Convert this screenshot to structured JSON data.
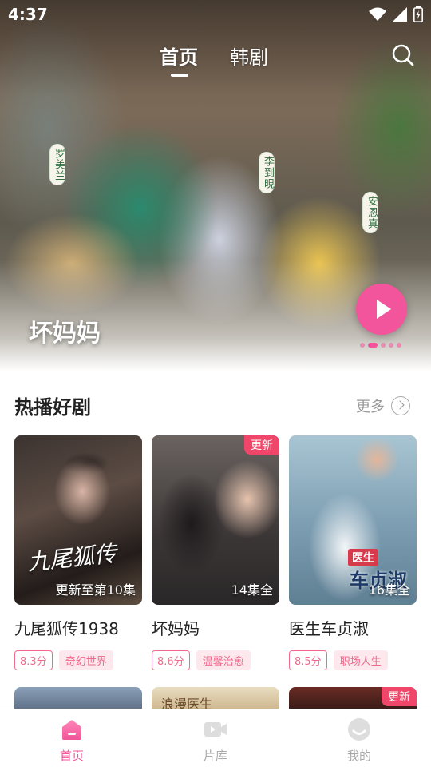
{
  "status_bar": {
    "time": "4:37"
  },
  "top_tabs": [
    {
      "label": "首页",
      "active": true
    },
    {
      "label": "韩剧",
      "active": false
    }
  ],
  "hero": {
    "title": "坏妈妈",
    "cast_labels": [
      "罗美兰",
      "李到晛",
      "安恩真"
    ],
    "carousel_total": 5,
    "carousel_active_index": 1
  },
  "section": {
    "title": "热播好剧",
    "more_label": "更多"
  },
  "cards": [
    {
      "title": "九尾狐传1938",
      "poster_text": "九尾狐传",
      "poster_note": "更新至第10集",
      "badge": "",
      "score": "8.3分",
      "genre": "奇幻世界"
    },
    {
      "title": "坏妈妈",
      "poster_note": "14集全",
      "badge": "更新",
      "score": "8.6分",
      "genre": "温馨治愈"
    },
    {
      "title": "医生车贞淑",
      "poster_logo": "医生",
      "poster_text": "车贞淑",
      "poster_note": "16集全",
      "badge": "",
      "score": "8.5分",
      "genre": "职场人生"
    }
  ],
  "second_row": {
    "third_badge": "更新",
    "peek_text": "浪漫医生"
  },
  "bottom_nav": [
    {
      "label": "首页",
      "icon": "home-icon",
      "active": true
    },
    {
      "label": "片库",
      "icon": "video-library-icon",
      "active": false
    },
    {
      "label": "我的",
      "icon": "profile-icon",
      "active": false
    }
  ],
  "colors": {
    "accent": "#f2559b",
    "badge": "#f0466a",
    "tag_text": "#f06a8c",
    "tag_bg": "#fde8ee"
  }
}
